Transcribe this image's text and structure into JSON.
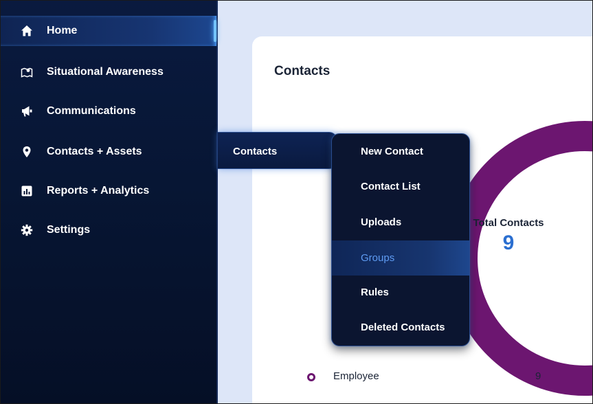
{
  "sidebar": {
    "items": [
      {
        "label": "Home",
        "icon": "home-icon",
        "active": true
      },
      {
        "label": "Situational Awareness",
        "icon": "map-icon"
      },
      {
        "label": "Communications",
        "icon": "megaphone-icon"
      },
      {
        "label": "Contacts + Assets",
        "icon": "location-pin-icon"
      },
      {
        "label": "Reports + Analytics",
        "icon": "bar-chart-icon"
      },
      {
        "label": "Settings",
        "icon": "gear-icon"
      }
    ]
  },
  "flyout": {
    "level1": {
      "label": "Contacts"
    },
    "level2": {
      "items": [
        {
          "label": "New Contact"
        },
        {
          "label": "Contact List"
        },
        {
          "label": "Uploads"
        },
        {
          "label": "Groups",
          "selected": true
        },
        {
          "label": "Rules"
        },
        {
          "label": "Deleted Contacts"
        }
      ]
    }
  },
  "card": {
    "title": "Contacts",
    "total_label": "Total Contacts",
    "total_value": "9",
    "legend": [
      {
        "label": "Employee",
        "count": "9",
        "color": "#6c1670"
      }
    ]
  },
  "colors": {
    "sidebar_bg": "#071634",
    "accent_glow": "#74c3ff",
    "donut": "#6c1670",
    "total_value": "#2b6fd0",
    "selected_text": "#5e9bf2"
  }
}
